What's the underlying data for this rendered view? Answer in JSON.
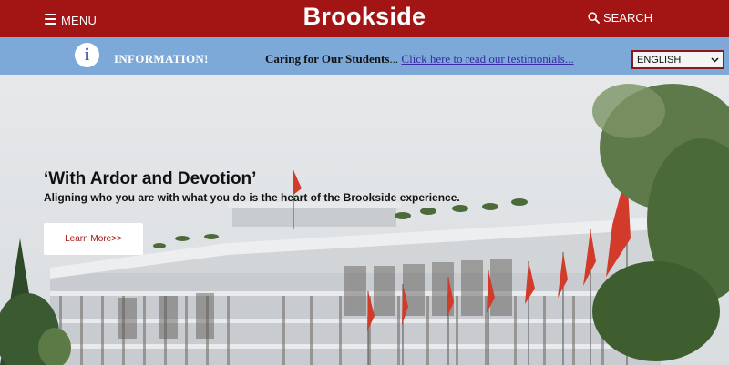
{
  "header": {
    "menu_label": "MENU",
    "brand": "Brookside",
    "search_label": "SEARCH"
  },
  "infobar": {
    "icon_letter": "i",
    "label": "INFORMATION!",
    "ticker_bold": "Caring for Our Students",
    "ticker_ellipsis": "...",
    "ticker_link": "Click here to read our testimonials..."
  },
  "language": {
    "selected": "ENGLISH"
  },
  "hero": {
    "title": "‘With Ardor and Devotion’",
    "subtitle": "Aligning who you are with what you do is the heart of the Brookside experience.",
    "cta_label": "Learn More>>"
  },
  "colors": {
    "brand_red": "#a31515",
    "info_blue": "#7da9d9"
  },
  "icons": [
    "hamburger-icon",
    "search-icon",
    "info-icon",
    "chevron-down-icon"
  ]
}
